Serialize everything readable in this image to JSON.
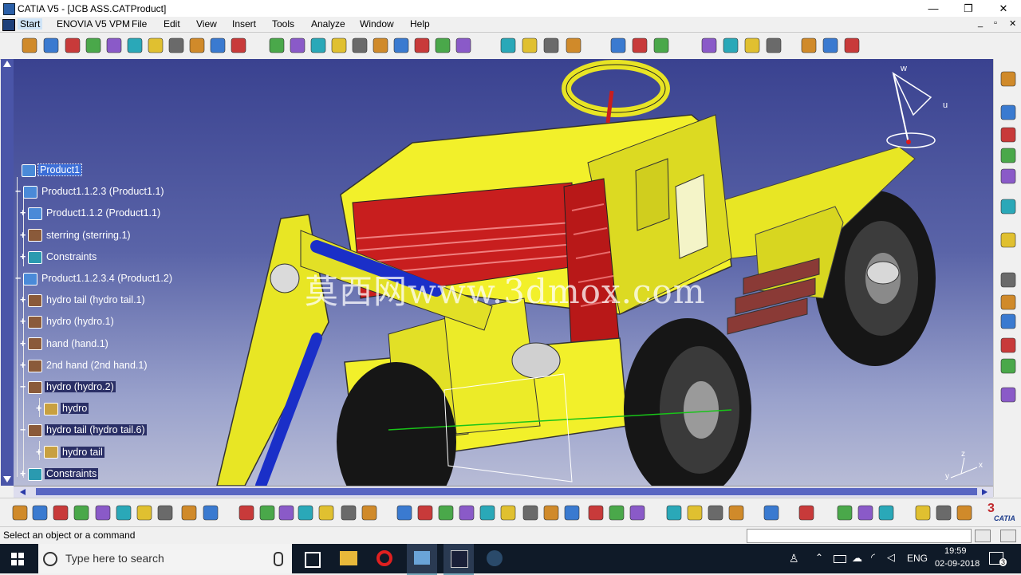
{
  "window": {
    "title": "CATIA V5 - [JCB ASS.CATProduct]",
    "minimize_glyph": "—",
    "maximize_glyph": "❐",
    "close_glyph": "✕",
    "inner_controls": [
      "_",
      "▫",
      "✕"
    ]
  },
  "menubar": {
    "items": [
      "Start",
      "ENOVIA V5 VPM",
      "File",
      "Edit",
      "View",
      "Insert",
      "Tools",
      "Analyze",
      "Window",
      "Help"
    ]
  },
  "tree": {
    "nodes": [
      {
        "label": "Product1",
        "depth": 0,
        "icon": "product-icon",
        "expander": "",
        "state": "selected"
      },
      {
        "label": "Product1.1.2.3 (Product1.1)",
        "depth": 1,
        "icon": "product-icon",
        "expander": "−",
        "state": ""
      },
      {
        "label": "Product1.1.2 (Product1.1)",
        "depth": 2,
        "icon": "product-icon",
        "expander": "+",
        "state": ""
      },
      {
        "label": "sterring (sterring.1)",
        "depth": 2,
        "icon": "part-icon",
        "expander": "+",
        "state": ""
      },
      {
        "label": "Constraints",
        "depth": 2,
        "icon": "constraints-icon",
        "expander": "+",
        "state": ""
      },
      {
        "label": "Product1.1.2.3.4 (Product1.2)",
        "depth": 1,
        "icon": "product-icon",
        "expander": "−",
        "state": ""
      },
      {
        "label": "hydro tail (hydro tail.1)",
        "depth": 2,
        "icon": "part-icon",
        "expander": "+",
        "state": ""
      },
      {
        "label": "hydro (hydro.1)",
        "depth": 2,
        "icon": "part-icon",
        "expander": "+",
        "state": ""
      },
      {
        "label": "hand (hand.1)",
        "depth": 2,
        "icon": "part-icon",
        "expander": "+",
        "state": ""
      },
      {
        "label": "2nd hand (2nd hand.1)",
        "depth": 2,
        "icon": "part-icon",
        "expander": "+",
        "state": ""
      },
      {
        "label": "hydro (hydro.2)",
        "depth": 2,
        "icon": "part-icon",
        "expander": "−",
        "state": "dark"
      },
      {
        "label": "hydro",
        "depth": 3,
        "icon": "gear-icon",
        "expander": "+",
        "state": "dark"
      },
      {
        "label": "hydro tail (hydro tail.6)",
        "depth": 2,
        "icon": "part-icon",
        "expander": "−",
        "state": "dark"
      },
      {
        "label": "hydro tail",
        "depth": 3,
        "icon": "gear-icon",
        "expander": "+",
        "state": "dark"
      },
      {
        "label": "Constraints",
        "depth": 2,
        "icon": "constraints-icon",
        "expander": "+",
        "state": "dark"
      }
    ]
  },
  "viewport": {
    "watermark": "莫西网www.3dmox.com",
    "compass_labels": {
      "w": "w",
      "u": "u"
    },
    "axis_labels": {
      "z": "z",
      "y": "y",
      "x": "x"
    },
    "brand": "CATIA"
  },
  "status": {
    "message": "Select an object or a command"
  },
  "taskbar": {
    "search_placeholder": "Type here to search",
    "language": "ENG",
    "time": "19:59",
    "date": "02-09-2018",
    "notification_count": "3"
  },
  "colors": {
    "viewport_top": "#3a4290",
    "vehicle_body": "#f2f02a",
    "seat_red": "#c81e1e",
    "tyre_black": "#161616",
    "selection_blue": "#3b6ed8"
  }
}
